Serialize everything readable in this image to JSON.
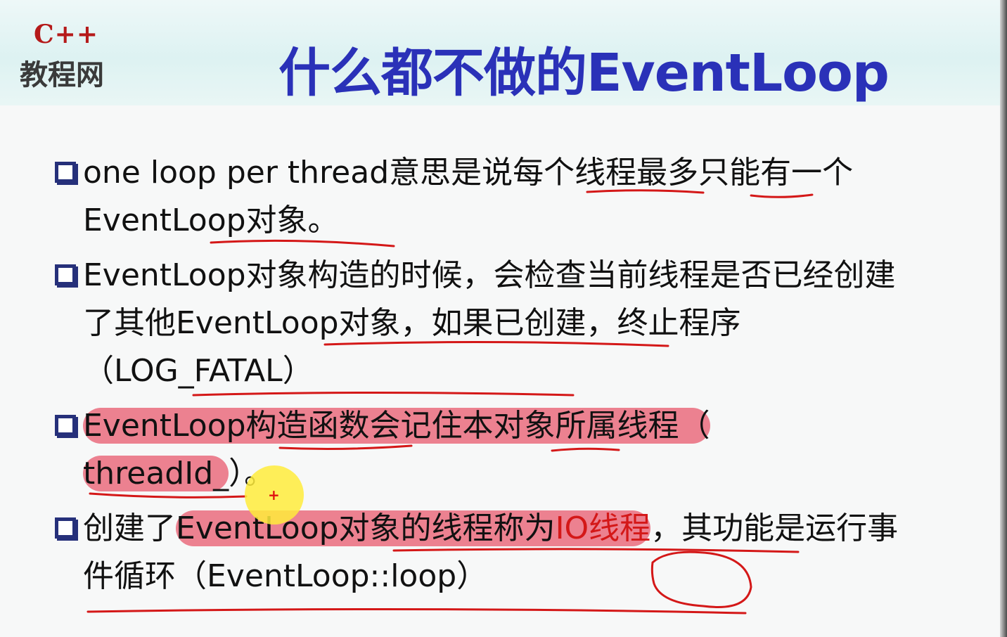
{
  "logo": {
    "top": "C++",
    "bottom": "教程网"
  },
  "title": "什么都不做的EventLoop",
  "bullets": [
    {
      "parts": [
        "one loop per thread意思是说每个线程最多只能有一个EventLoop对象。"
      ]
    },
    {
      "parts": [
        "EventLoop对象构造的时候，会检查当前线程是否已经创建了其他EventLoop对象，如果已创建，终止程序（LOG_FATAL）"
      ]
    },
    {
      "parts": [
        "EventLoop构造函数会记住本对象所属线程（",
        "threadId_",
        "）。"
      ]
    },
    {
      "parts": [
        "创建了",
        "EventLoop对象的线程称为",
        "IO线程",
        "，其功能是运行事件循环（EventLoop::loop）"
      ]
    }
  ],
  "colors": {
    "title": "#2a31b8",
    "annotation": "#d41818",
    "highlight": "#e85a6e",
    "logo_red": "#b51a1a"
  }
}
